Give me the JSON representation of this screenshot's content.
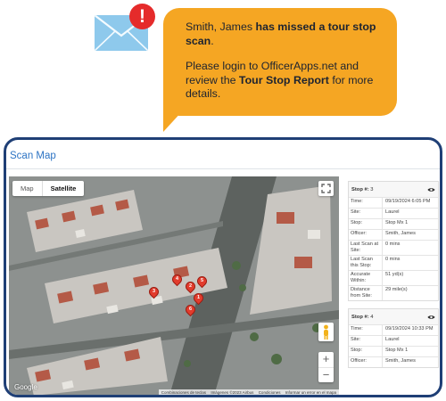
{
  "notification": {
    "envelope_icon": "envelope-icon",
    "alert_icon": "exclamation-icon",
    "alert_badge": "!",
    "line1_pre": "Smith, James ",
    "line1_bold": "has missed a tour stop scan",
    "line1_post": ".",
    "line2_pre": "Please login to OfficerApps.net and review the ",
    "line2_bold": "Tour Stop Report",
    "line2_post": " for more details.",
    "colors": {
      "bubble": "#f5a623",
      "card_border": "#1f3f76",
      "badge": "#e52b2b"
    }
  },
  "scan_map": {
    "title": "Scan Map",
    "map": {
      "type_options": [
        "Map",
        "Satellite"
      ],
      "selected_type": "Satellite",
      "zoom_in": "+",
      "zoom_out": "−",
      "logo": "Google",
      "attribution": [
        "Combinaciones de teclas",
        "Imágenes ©2023 Airbus",
        "Condiciones",
        "Informar un error en el mapa"
      ],
      "markers": [
        "4",
        "2",
        "3",
        "5",
        "1",
        "6"
      ]
    },
    "stops": [
      {
        "stop_label": "Stop #: ",
        "stop_number": "3",
        "rows": [
          {
            "key": "Time:",
            "value": "09/19/2024 6:05 PM"
          },
          {
            "key": "Site:",
            "value": "Laurel"
          },
          {
            "key": "Stop:",
            "value": "Stop Mx 1"
          },
          {
            "key": "Officer:",
            "value": "Smith, James"
          },
          {
            "key": "Last Scan at Site:",
            "value": "0 mins"
          },
          {
            "key": "Last Scan this Stop:",
            "value": "0 mins"
          },
          {
            "key": "Accurate Within:",
            "value": "51 yd(s)"
          },
          {
            "key": "Distance from Site:",
            "value": "29 mile(s)"
          }
        ]
      },
      {
        "stop_label": "Stop #: ",
        "stop_number": "4",
        "rows": [
          {
            "key": "Time:",
            "value": "09/19/2024 10:33 PM"
          },
          {
            "key": "Site:",
            "value": "Laurel"
          },
          {
            "key": "Stop:",
            "value": "Stop Mx 1"
          },
          {
            "key": "Officer:",
            "value": "Smith, James"
          }
        ]
      }
    ]
  }
}
